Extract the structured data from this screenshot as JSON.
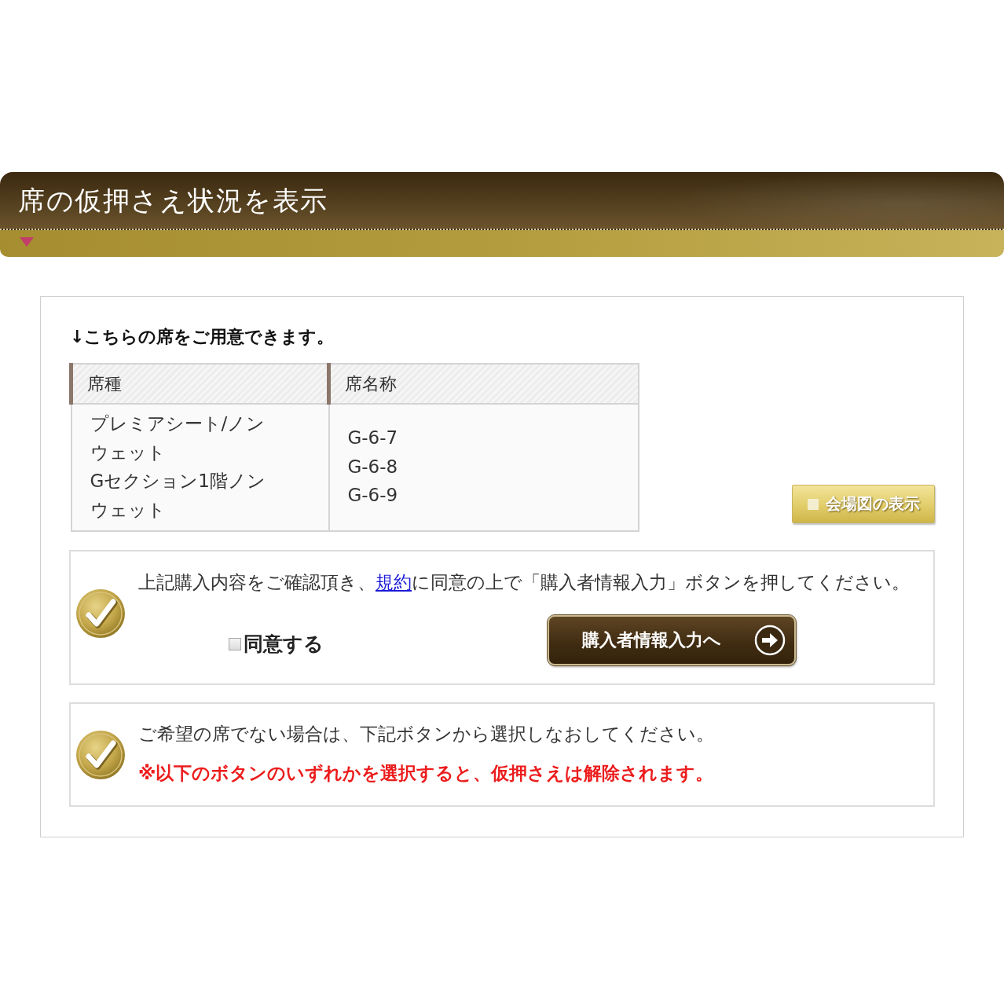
{
  "header": {
    "title": "席の仮押さえ状況を表示"
  },
  "intro": "↓こちらの席をご用意できます。",
  "seat_table": {
    "columns": [
      "席種",
      "席名称"
    ],
    "rows": [
      {
        "seat_types": [
          "プレミアシート/ノンウェット",
          "Gセクション1階ノンウェット"
        ],
        "seat_names": [
          "G-6-7",
          "G-6-8",
          "G-6-9"
        ]
      }
    ]
  },
  "venue_map_button": {
    "label": "会場図の表示"
  },
  "confirmation": {
    "text_before": "上記購入内容をご確認頂き、",
    "link": "規約",
    "text_after": "に同意の上で「購入者情報入力」ボタンを押してください。",
    "agreement": {
      "label": "同意する",
      "checked": false
    },
    "next_button": {
      "label": "購入者情報入力へ"
    }
  },
  "reselect": {
    "text": "ご希望の席でない場合は、下記ボタンから選択しなおしてください。",
    "warning": "※以下のボタンのいずれかを選択すると、仮押さえは解除されます。"
  }
}
